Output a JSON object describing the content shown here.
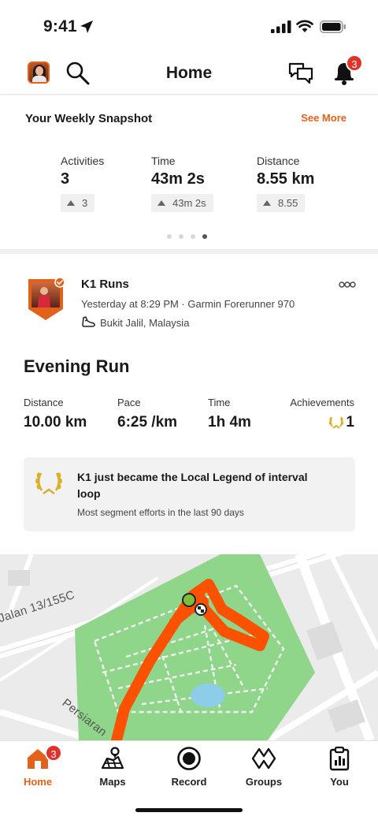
{
  "status_bar": {
    "time": "9:41"
  },
  "header": {
    "title": "Home",
    "notifications_count": "3",
    "icons": [
      "avatar",
      "search-icon",
      "chat-icon",
      "bell-icon"
    ]
  },
  "snapshot": {
    "title": "Your Weekly Snapshot",
    "see_more": "See More",
    "stats": [
      {
        "label": "Activities",
        "value": "3",
        "change": "3"
      },
      {
        "label": "Time",
        "value": "43m 2s",
        "change": "43m 2s"
      },
      {
        "label": "Distance",
        "value": "8.55 km",
        "change": "8.55"
      }
    ],
    "page_dots": 4,
    "active_dot": 4
  },
  "activity": {
    "athlete": "K1 Runs",
    "meta": "Yesterday at 8:29 PM · Garmin Forerunner 970",
    "location": "Bukit Jalil, Malaysia",
    "title": "Evening Run",
    "metrics": [
      {
        "label": "Distance",
        "value": "10.00 km"
      },
      {
        "label": "Pace",
        "value": "6:25 /km"
      },
      {
        "label": "Time",
        "value": "1h 4m"
      }
    ],
    "achievements_label": "Achievements",
    "achievements_value": "1",
    "legend": {
      "title": "K1 just became the Local Legend of interval loop",
      "subtitle": "Most segment efforts in the last 90 days"
    }
  },
  "map": {
    "street_labels": [
      "Jalan 13/155C",
      "Persiaran"
    ],
    "colors": {
      "route": "#fc5200",
      "park": "#8fd68a",
      "start": "#7cbf3a"
    }
  },
  "tabs": [
    {
      "label": "Home",
      "icon": "home-icon",
      "badge": "3",
      "active": true
    },
    {
      "label": "Maps",
      "icon": "maps-icon"
    },
    {
      "label": "Record",
      "icon": "record-icon"
    },
    {
      "label": "Groups",
      "icon": "groups-icon"
    },
    {
      "label": "You",
      "icon": "you-icon"
    }
  ],
  "colors": {
    "accent": "#e2621b",
    "badge": "#e0322b",
    "gold": "#d9b02a"
  }
}
